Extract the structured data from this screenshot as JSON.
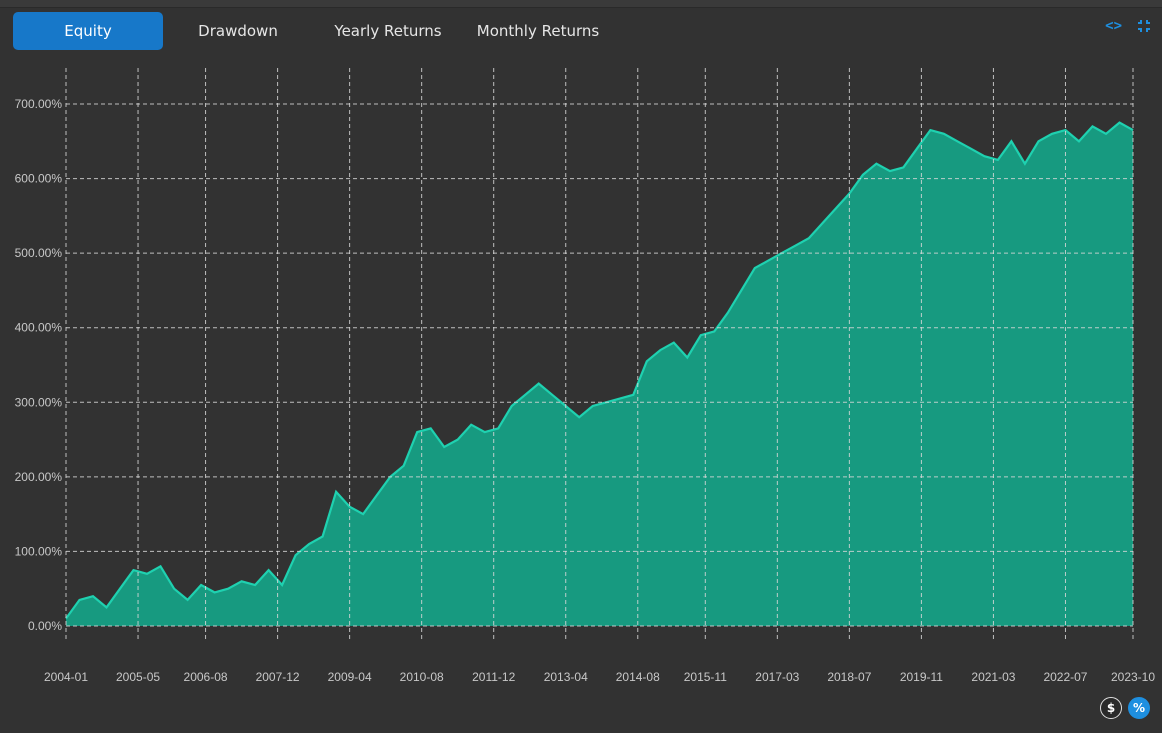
{
  "tabs": [
    {
      "label": "Equity",
      "active": true
    },
    {
      "label": "Drawdown",
      "active": false
    },
    {
      "label": "Yearly Returns",
      "active": false
    },
    {
      "label": "Monthly Returns",
      "active": false
    }
  ],
  "icons": {
    "expand": "code-brackets-icon",
    "collapse": "compress-icon"
  },
  "buttons": {
    "dollar": "$",
    "percent": "%"
  },
  "colors": {
    "background": "#323232",
    "accent": "#1778c9",
    "series_line": "#1fd1b0",
    "series_fill": "#16a085",
    "grid": "#d8d8d8"
  },
  "chart_data": {
    "type": "area",
    "title": "",
    "xlabel": "",
    "ylabel": "",
    "ylim": [
      0,
      700
    ],
    "y_ticks": [
      "0.00%",
      "100.00%",
      "200.00%",
      "300.00%",
      "400.00%",
      "500.00%",
      "600.00%",
      "700.00%"
    ],
    "x_ticks": [
      "2004-01",
      "2005-05",
      "2006-08",
      "2007-12",
      "2009-04",
      "2010-08",
      "2011-12",
      "2013-04",
      "2014-08",
      "2015-11",
      "2017-03",
      "2018-07",
      "2019-11",
      "2021-03",
      "2022-07",
      "2023-10"
    ],
    "grid": true,
    "series": [
      {
        "x": [
          "2004-01",
          "2004-04",
          "2004-07",
          "2004-10",
          "2005-01",
          "2005-04",
          "2005-07",
          "2005-10",
          "2006-01",
          "2006-04",
          "2006-07",
          "2006-10",
          "2007-01",
          "2007-04",
          "2007-07",
          "2007-10",
          "2008-01",
          "2008-04",
          "2008-07",
          "2008-10",
          "2009-01",
          "2009-04",
          "2009-07",
          "2009-10",
          "2010-01",
          "2010-04",
          "2010-07",
          "2010-10",
          "2011-01",
          "2011-04",
          "2011-07",
          "2011-10",
          "2012-01",
          "2012-04",
          "2012-07",
          "2012-10",
          "2013-01",
          "2013-04",
          "2013-07",
          "2013-10",
          "2014-01",
          "2014-04",
          "2014-07",
          "2014-10",
          "2015-01",
          "2015-04",
          "2015-07",
          "2015-10",
          "2016-01",
          "2016-04",
          "2016-07",
          "2016-10",
          "2017-01",
          "2017-04",
          "2017-07",
          "2017-10",
          "2018-01",
          "2018-04",
          "2018-07",
          "2018-10",
          "2019-01",
          "2019-04",
          "2019-07",
          "2019-10",
          "2020-01",
          "2020-04",
          "2020-07",
          "2020-10",
          "2021-01",
          "2021-04",
          "2021-07",
          "2021-10",
          "2022-01",
          "2022-04",
          "2022-07",
          "2022-10",
          "2023-01",
          "2023-04",
          "2023-07",
          "2023-10"
        ],
        "values": [
          10,
          35,
          40,
          25,
          50,
          75,
          70,
          80,
          50,
          35,
          55,
          45,
          50,
          60,
          55,
          75,
          55,
          95,
          110,
          120,
          180,
          160,
          150,
          175,
          200,
          215,
          260,
          265,
          240,
          250,
          270,
          260,
          265,
          295,
          310,
          325,
          310,
          295,
          280,
          295,
          300,
          305,
          310,
          355,
          370,
          380,
          360,
          390,
          395,
          420,
          450,
          480,
          490,
          500,
          510,
          520,
          540,
          560,
          580,
          605,
          620,
          610,
          615,
          640,
          665,
          660,
          650,
          640,
          630,
          625,
          650,
          620,
          650,
          660,
          665,
          650,
          670,
          660,
          675,
          665
        ]
      }
    ]
  }
}
